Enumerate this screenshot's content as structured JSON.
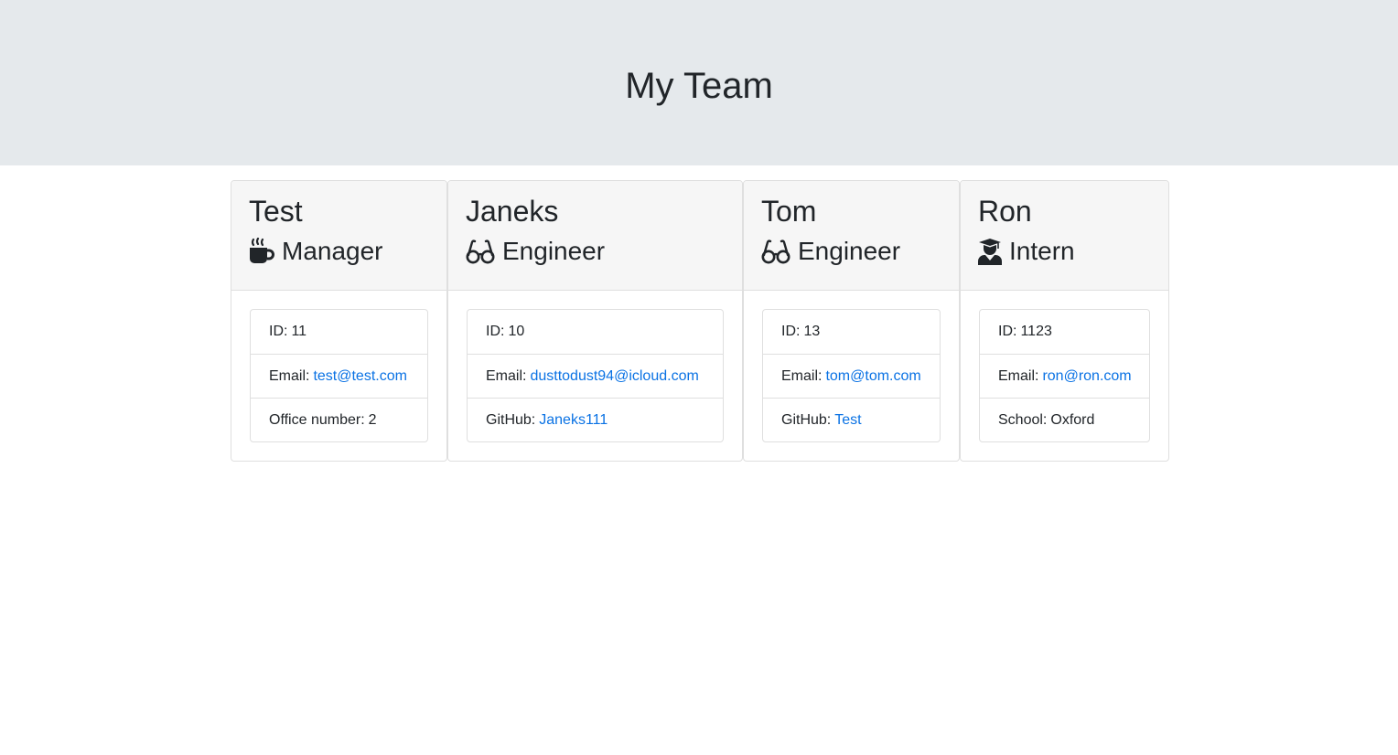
{
  "header": {
    "title": "My Team"
  },
  "team": [
    {
      "name": "Test",
      "role": "Manager",
      "icon": "mug-icon",
      "id_label": "ID:",
      "id": "11",
      "email_label": "Email:",
      "email": "test@test.com",
      "extra_label": "Office number:",
      "extra_value": "2"
    },
    {
      "name": "Janeks",
      "role": "Engineer",
      "icon": "glasses-icon",
      "id_label": "ID:",
      "id": "10",
      "email_label": "Email:",
      "email": "dusttodust94@icloud.com",
      "extra_label": "GitHub:",
      "extra_value": "Janeks111"
    },
    {
      "name": "Tom",
      "role": "Engineer",
      "icon": "glasses-icon",
      "id_label": "ID:",
      "id": "13",
      "email_label": "Email:",
      "email": "tom@tom.com",
      "extra_label": "GitHub:",
      "extra_value": "Test"
    },
    {
      "name": "Ron",
      "role": "Intern",
      "icon": "graduate-icon",
      "id_label": "ID:",
      "id": "1123",
      "email_label": "Email:",
      "email": "ron@ron.com",
      "extra_label": "School:",
      "extra_value": "Oxford"
    }
  ],
  "colors": {
    "header_bg": "#e5e9ec",
    "link": "#0a72e4",
    "card_header_bg": "#f6f6f6",
    "border": "#dfdfdf"
  }
}
